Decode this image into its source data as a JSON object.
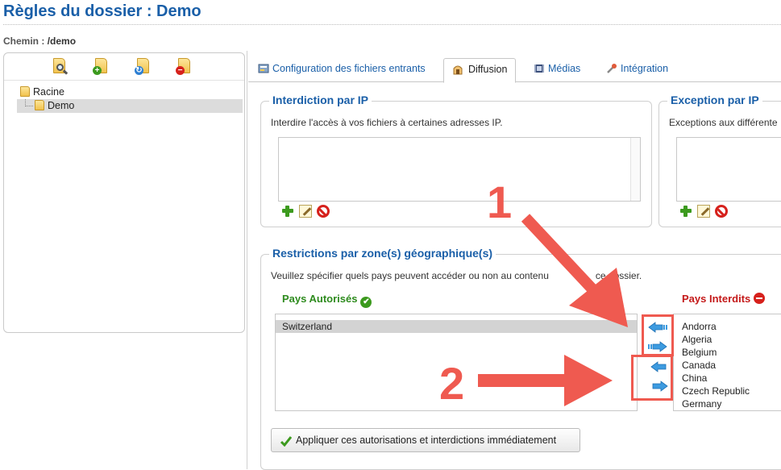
{
  "page": {
    "title": "Règles du dossier : Demo",
    "path_label": "Chemin :",
    "path_value": "/demo"
  },
  "tree": {
    "toolbar": [
      {
        "icon": "folder-search-icon"
      },
      {
        "icon": "folder-add-icon"
      },
      {
        "icon": "folder-refresh-icon"
      },
      {
        "icon": "folder-remove-icon"
      }
    ],
    "root_label": "Racine",
    "child_label": "Demo"
  },
  "tabs": [
    {
      "label": "Configuration des fichiers entrants",
      "icon": "config-icon",
      "active": false
    },
    {
      "label": "Diffusion",
      "icon": "diffusion-icon",
      "active": true
    },
    {
      "label": "Médias",
      "icon": "media-icon",
      "active": false
    },
    {
      "label": "Intégration",
      "icon": "integration-icon",
      "active": false
    }
  ],
  "ip_block": {
    "title": "Interdiction par IP",
    "description": "Interdire l'accès à vos fichiers à certaines adresses IP."
  },
  "ip_exception": {
    "title": "Exception par IP",
    "description": "Exceptions aux différente"
  },
  "geo": {
    "title": "Restrictions par zone(s) géographique(s)",
    "description": "Veuillez spécifier quels pays peuvent accéder ou non au contenu",
    "description_tail": "ce dossier.",
    "allowed_header": "Pays Autorisés",
    "forbidden_header": "Pays Interdits",
    "allowed": [
      "Switzerland"
    ],
    "forbidden": [
      "Andorra",
      "Algeria",
      "Belgium",
      "Canada",
      "China",
      "Czech Republic",
      "Germany"
    ],
    "apply_label": "Appliquer ces autorisations et interdictions immédiatement"
  },
  "annotations": {
    "step1": "1",
    "step2": "2"
  },
  "colors": {
    "title_blue": "#1a5fa8",
    "allowed_green": "#2e8b1e",
    "forbidden_red": "#c41a1a",
    "annotation_red": "#ef5a50",
    "arrow_blue": "#3d9be0"
  }
}
